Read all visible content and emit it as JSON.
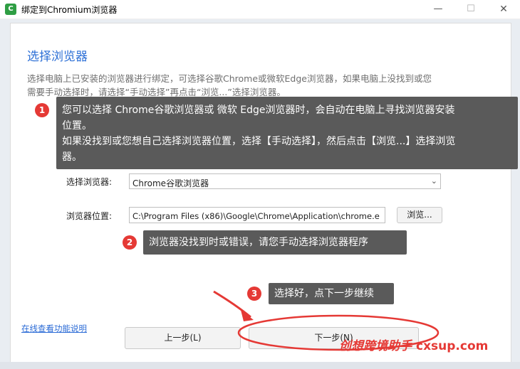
{
  "window": {
    "title": "绑定到Chromium浏览器",
    "app_icon_glyph": "C",
    "controls": {
      "minimize": "—",
      "maximize": "☐",
      "close": "✕"
    }
  },
  "page": {
    "heading": "选择浏览器",
    "description_line1": "选择电脑上已安装的浏览器进行绑定，可选择谷歌Chrome或微软Edge浏览器，如果电脑上没找到或您",
    "description_line2": "需要手动选择时，请选择“手动选择”再点击“浏览...”选择浏览器。"
  },
  "form": {
    "browser_label": "选择浏览器:",
    "browser_value": "Chrome谷歌浏览器",
    "location_label": "浏览器位置:",
    "location_value": "C:\\Program Files (x86)\\Google\\Chrome\\Application\\chrome.e",
    "browse_button": "浏览..."
  },
  "footer": {
    "help_link": "在线查看功能说明",
    "prev_button": "上一步(L)",
    "next_button": "下一步(N)"
  },
  "tips": [
    {
      "number": "1",
      "line1": "您可以选择 Chrome谷歌浏览器或 微软 Edge浏览器时，会自动在电脑上寻找浏览器安装",
      "line2": "位置。",
      "line3": "如果没找到或您想自己选择浏览器位置，选择【手动选择】，然后点击【浏览...】选择浏览",
      "line4": "器。"
    },
    {
      "number": "2",
      "line1": "浏览器没找到时或错误，请您手动选择浏览器程序"
    },
    {
      "number": "3",
      "line1": "选择好，点下一步继续"
    }
  ],
  "watermark": {
    "brand": "创想跨境助手",
    "domain": "cxsup.com"
  },
  "colors": {
    "accent": "#2c6fd6",
    "tip_bg": "#5a5a5a",
    "badge": "#e53935",
    "annotation": "#e53935"
  }
}
